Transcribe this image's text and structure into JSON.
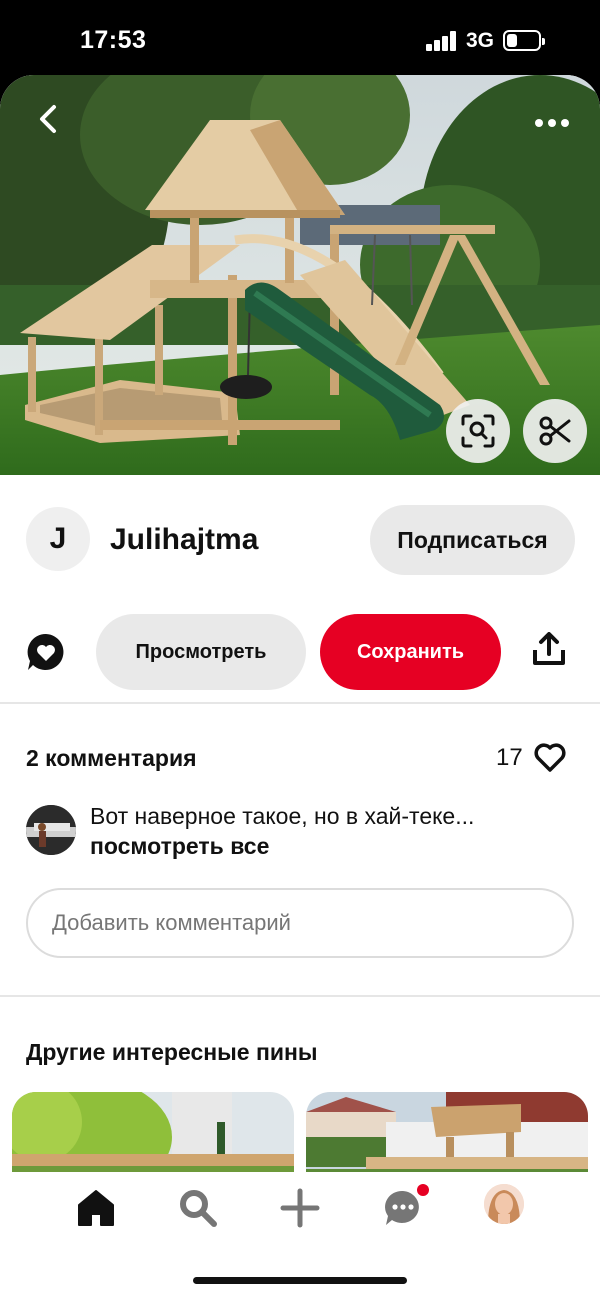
{
  "status_bar": {
    "time": "17:53",
    "network": "3G"
  },
  "pin": {
    "author_initial": "J",
    "author_name": "Julihajtma",
    "follow_label": "Подписаться",
    "view_label": "Просмотреть",
    "save_label": "Сохранить"
  },
  "comments": {
    "title": "2 комментария",
    "likes": "17",
    "preview_text": "Вот наверное такое, но в хай-теке...",
    "see_all": "посмотреть все",
    "add_placeholder": "Добавить комментарий"
  },
  "more_pins": {
    "title": "Другие интересные пины"
  },
  "icons": {
    "back": "back-icon",
    "more": "more-icon",
    "visual_search": "visual-search-icon",
    "scissors": "scissors-icon",
    "comment": "comment-heart-icon",
    "share": "share-icon",
    "heart": "heart-icon",
    "home": "home-icon",
    "search": "search-icon",
    "add": "plus-icon",
    "messages": "messages-icon"
  },
  "colors": {
    "accent": "#e60023",
    "button_gray": "#e9e9e9",
    "text": "#111111"
  }
}
